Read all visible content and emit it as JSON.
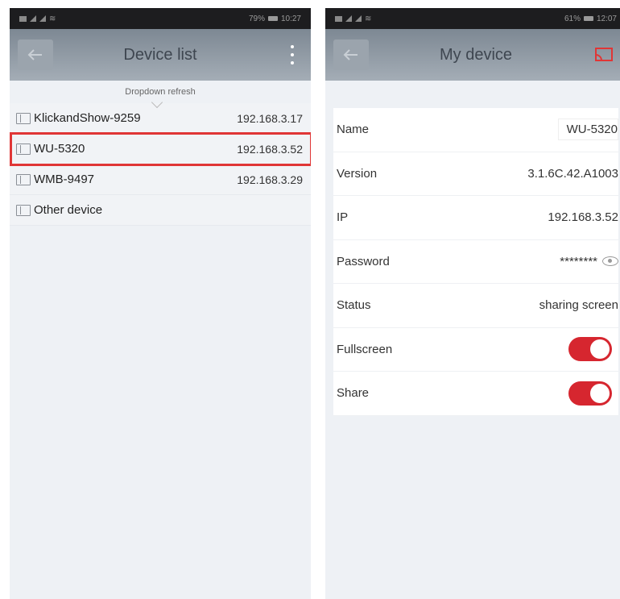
{
  "left": {
    "status": {
      "battery": "79%",
      "time": "10:27"
    },
    "title": "Device list",
    "dropdown_hint": "Dropdown refresh",
    "devices": [
      {
        "name": "KlickandShow-9259",
        "ip": "192.168.3.17"
      },
      {
        "name": "WU-5320",
        "ip": "192.168.3.52"
      },
      {
        "name": "WMB-9497",
        "ip": "192.168.3.29"
      },
      {
        "name": "Other device",
        "ip": ""
      }
    ]
  },
  "right": {
    "status": {
      "battery": "61%",
      "time": "12:07"
    },
    "title": "My device",
    "fields": {
      "name": {
        "label": "Name",
        "value": "WU-5320"
      },
      "version": {
        "label": "Version",
        "value": "3.1.6C.42.A1003"
      },
      "ip": {
        "label": "IP",
        "value": "192.168.3.52"
      },
      "password": {
        "label": "Password",
        "value": "********"
      },
      "status": {
        "label": "Status",
        "value": "sharing screen"
      },
      "fullscreen": {
        "label": "Fullscreen",
        "on": true
      },
      "share": {
        "label": "Share",
        "on": true
      }
    }
  },
  "colors": {
    "accent": "#d6262f",
    "selection": "#e03636",
    "appbar": "#8f99a3"
  },
  "icons": {
    "back": "back-arrow-icon",
    "menu": "more-vertical-icon",
    "cast": "cast-screen-icon",
    "device": "device-icon",
    "eye": "eye-icon"
  }
}
